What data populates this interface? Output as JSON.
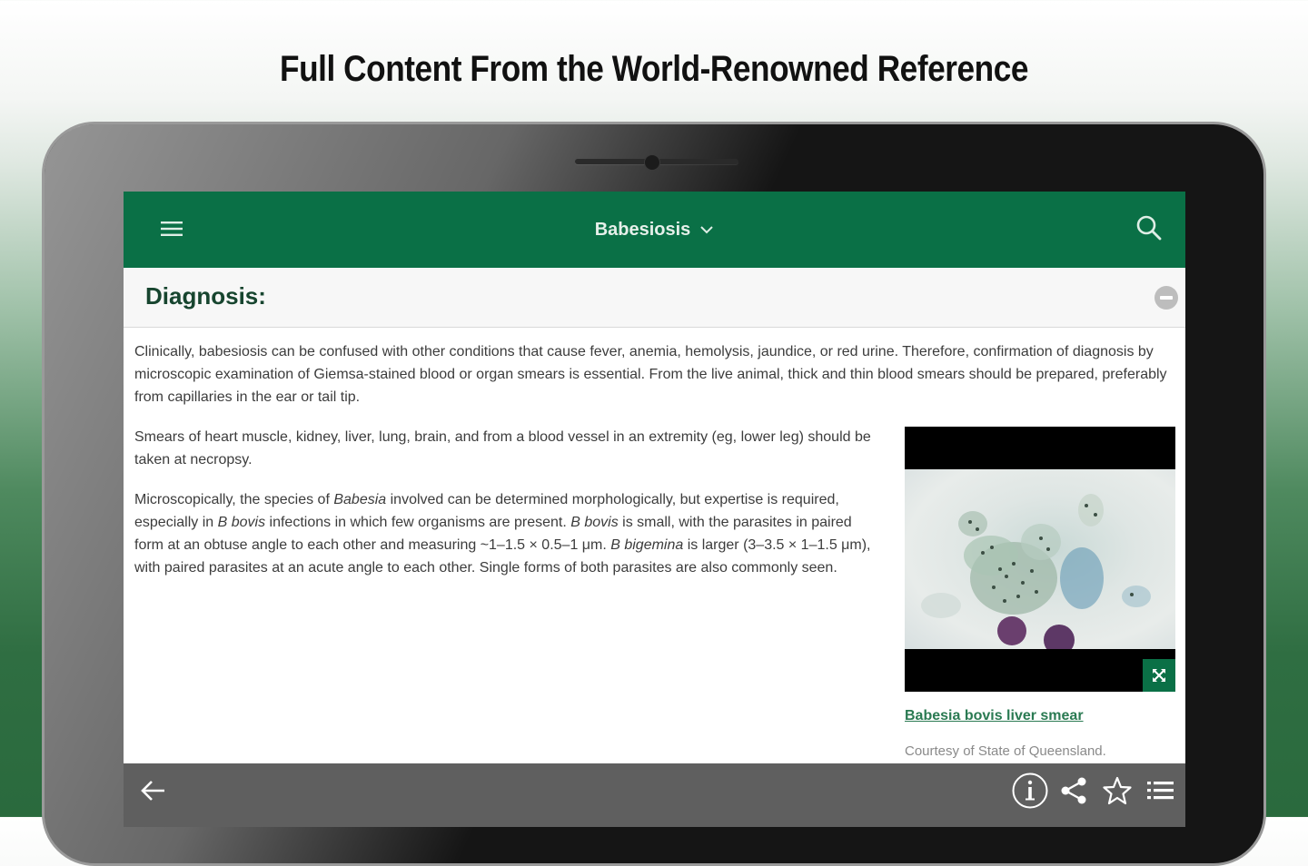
{
  "promo": {
    "headline": "Full Content From the World-Renowned Reference"
  },
  "appbar": {
    "title": "Babesiosis",
    "menu_icon": "hamburger-menu-icon",
    "dropdown_icon": "chevron-down-icon",
    "search_icon": "search-icon",
    "color": "#0a7046"
  },
  "section": {
    "title": "Diagnosis:",
    "collapse_icon": "minus-circle-icon"
  },
  "body": {
    "p1": "Clinically, babesiosis can be confused with other conditions that cause fever, anemia, hemolysis, jaundice, or red urine. Therefore, confirmation of diagnosis by microscopic examination of Giemsa-stained blood or organ smears is essential. From the live animal, thick and thin blood smears should be prepared, preferably from capillaries in the ear or tail tip.",
    "p2": "Smears of heart muscle, kidney, liver, lung, brain, and from a blood vessel in an extremity (eg, lower leg) should be taken at necropsy.",
    "p3": {
      "t1": "Microscopically, the species of ",
      "i1": "Babesia",
      "t2": " involved can be determined morphologically, but expertise is required, especially in ",
      "i2": "B bovis",
      "t3": " infections in which few organisms are present. ",
      "i3": "B bovis",
      "t4": " is small, with the parasites in paired form at an obtuse angle to each other and measuring ~1–1.5 × 0.5–1 μm. ",
      "i4": "B bigemina",
      "t5": " is larger (3–3.5 × 1–1.5 μm), with paired parasites at an acute angle to each other. Single forms of both parasites are also commonly seen."
    }
  },
  "figure": {
    "caption": "Babesia bovis liver smear",
    "credit": "Courtesy of State of Queensland.",
    "expand_icon": "expand-icon"
  },
  "bottombar": {
    "back_icon": "back-arrow-icon",
    "info_icon": "info-icon",
    "share_icon": "share-icon",
    "star_icon": "star-icon",
    "list_icon": "list-icon"
  }
}
